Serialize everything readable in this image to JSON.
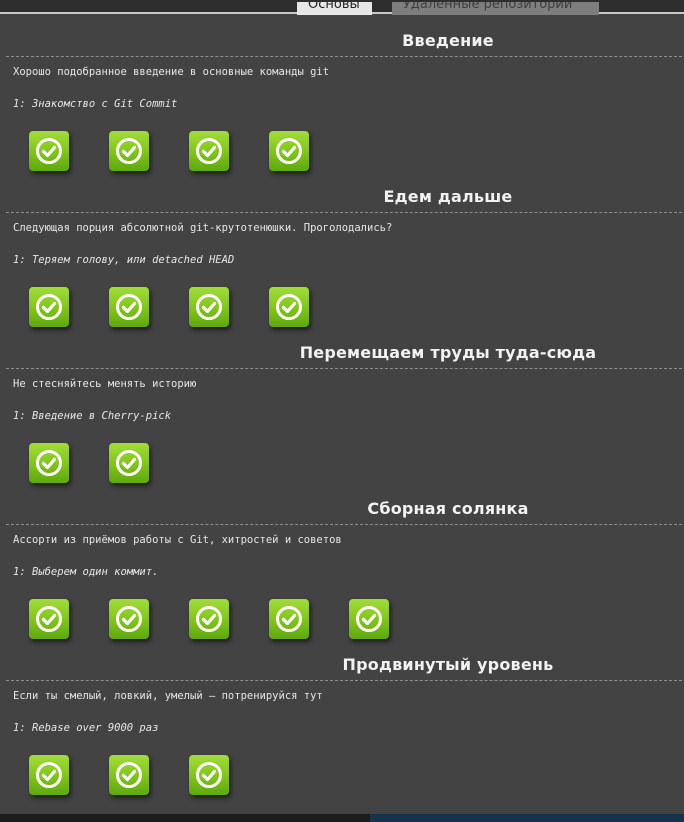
{
  "tabs": [
    {
      "label": "Основы",
      "active": true
    },
    {
      "label": "Удаленные репозитории",
      "active": false
    }
  ],
  "level_button_icon": "check-circle-icon",
  "accent_color": "#80c41a",
  "sections": [
    {
      "title": "Введение",
      "description": "Хорошо подобранное введение в основные команды git",
      "first_level": "1: Знакомство с Git Commit",
      "levels_completed": 4
    },
    {
      "title": "Едем дальше",
      "description": "Следующая порция абсолютной git-крутотенюшки. Проголодались?",
      "first_level": "1: Теряем голову, или detached HEAD",
      "levels_completed": 4
    },
    {
      "title": "Перемещаем труды туда-сюда",
      "description": "Не стесняйтесь менять историю",
      "first_level": "1: Введение в Cherry-pick",
      "levels_completed": 2
    },
    {
      "title": "Сборная солянка",
      "description": "Ассорти из приёмов работы с Git, хитростей и советов",
      "first_level": "1: Выберем один коммит.",
      "levels_completed": 5
    },
    {
      "title": "Продвинутый уровень",
      "description": "Если ты смелый, ловкий, умелый – потренируйся тут",
      "first_level": "1: Rebase over 9000 раз",
      "levels_completed": 3
    }
  ]
}
